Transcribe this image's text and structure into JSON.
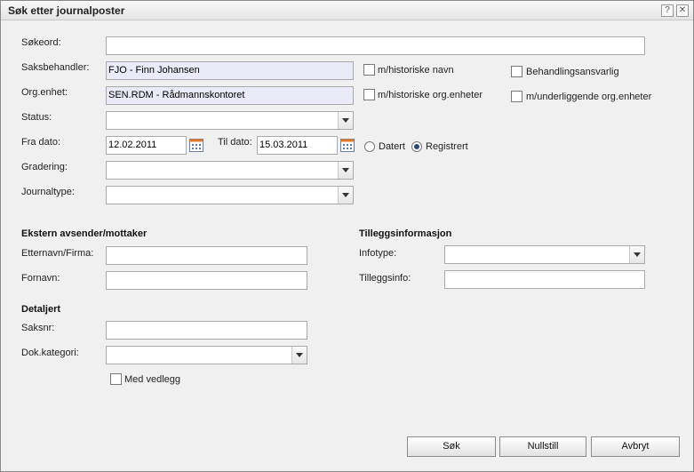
{
  "window": {
    "title": "Søk etter journalposter",
    "help_label": "?",
    "close_label": "✕"
  },
  "search": {
    "label": "Søkeord:",
    "value": ""
  },
  "saksbehandler": {
    "label": "Saksbehandler:",
    "value": "FJO - Finn Johansen"
  },
  "orgenhet": {
    "label": "Org.enhet:",
    "value": "SEN.RDM - Rådmannskontoret"
  },
  "options": {
    "historiske_navn": "m/historiske navn",
    "historiske_org": "m/historiske org.enheter",
    "behandlingsansvarlig": "Behandlingsansvarlig",
    "underliggende": "m/underliggende org.enheter"
  },
  "status": {
    "label": "Status:",
    "value": ""
  },
  "fra_dato": {
    "label": "Fra dato:",
    "value": "12.02.2011"
  },
  "til_dato": {
    "label": "Til dato:",
    "value": "15.03.2011"
  },
  "date_type": {
    "datert": "Datert",
    "registrert": "Registrert",
    "selected": "registrert"
  },
  "gradering": {
    "label": "Gradering:",
    "value": ""
  },
  "journaltype": {
    "label": "Journaltype:",
    "value": ""
  },
  "ekstern": {
    "heading": "Ekstern avsender/mottaker",
    "etternavn_label": "Etternavn/Firma:",
    "fornavn_label": "Fornavn:"
  },
  "tillegg": {
    "heading": "Tilleggsinformasjon",
    "infotype_label": "Infotype:",
    "tilleggsinfo_label": "Tilleggsinfo:"
  },
  "detaljert": {
    "heading": "Detaljert",
    "saksnr_label": "Saksnr:",
    "dokkategori_label": "Dok.kategori:",
    "med_vedlegg": "Med vedlegg"
  },
  "buttons": {
    "sok": "Søk",
    "nullstill": "Nullstill",
    "avbryt": "Avbryt"
  },
  "colors": {
    "filled_bg": "#eaeaf8",
    "radio_dot": "#2b4a7a"
  },
  "icons": {
    "calendar": "calendar-icon",
    "dropdown": "chevron-down-icon"
  }
}
